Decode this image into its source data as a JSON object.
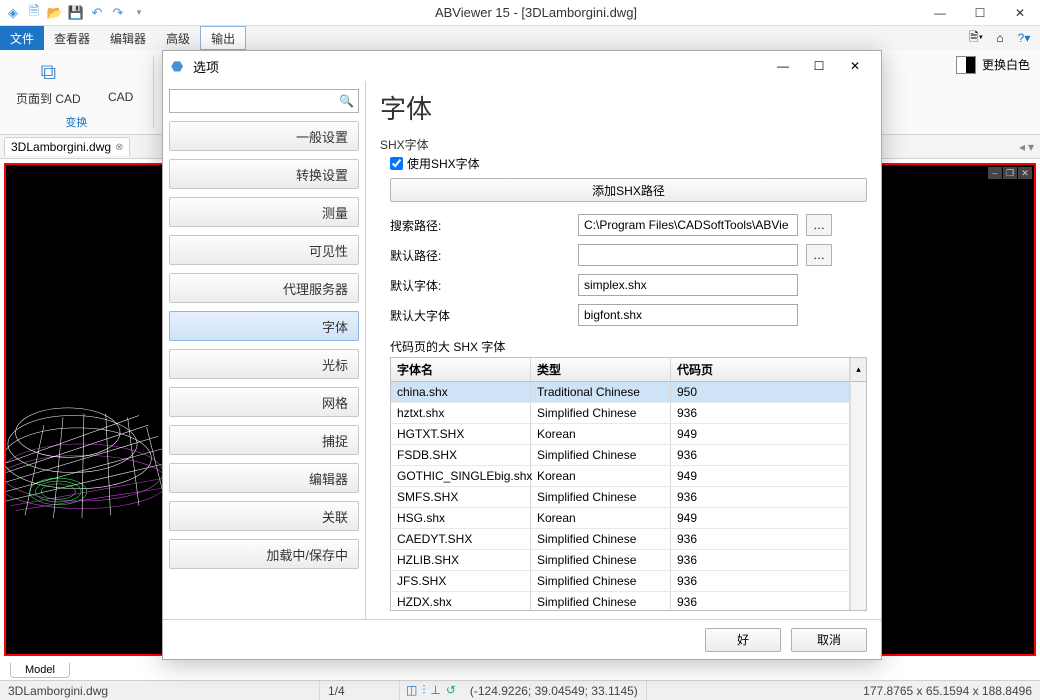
{
  "app": {
    "title": "ABViewer 15 - [3DLamborgini.dwg]"
  },
  "menu": {
    "file": "文件",
    "viewer": "查看器",
    "editor": "编辑器",
    "advanced": "高级",
    "output": "输出"
  },
  "ribbon": {
    "page_to_cad": "页面到 CAD",
    "cad_partial": "CAD",
    "convert": "变换",
    "replace_white": "更换白色"
  },
  "doctab": {
    "name": "3DLamborgini.dwg"
  },
  "modeltab": "Model",
  "status": {
    "file": "3DLamborgini.dwg",
    "page": "1/4",
    "coords": "(-124.9226; 39.04549; 33.1145)",
    "dims": "177.8765 x 65.1594 x 188.8496"
  },
  "dialog": {
    "title": "选项",
    "search_placeholder": "",
    "side": {
      "general": "一般设置",
      "convert": "转换设置",
      "measure": "测量",
      "visibility": "可见性",
      "proxy": "代理服务器",
      "font": "字体",
      "cursor": "光标",
      "grid": "网格",
      "snap": "捕捉",
      "editor": "编辑器",
      "assoc": "关联",
      "loading": "加载中/保存中"
    },
    "main": {
      "heading": "字体",
      "shx_group": "SHX字体",
      "use_shx": "使用SHX字体",
      "add_shx_path": "添加SHX路径",
      "search_path_label": "搜索路径:",
      "search_path_value": "C:\\Program Files\\CADSoftTools\\ABVie",
      "default_path_label": "默认路径:",
      "default_path_value": "",
      "default_font_label": "默认字体:",
      "default_font_value": "simplex.shx",
      "default_bigfont_label": "默认大字体",
      "default_bigfont_value": "bigfont.shx",
      "codepage_label": "代码页的大 SHX 字体",
      "col_name": "字体名",
      "col_type": "类型",
      "col_codepage": "代码页",
      "rows": [
        {
          "name": "china.shx",
          "type": "Traditional Chinese",
          "cp": "950"
        },
        {
          "name": "hztxt.shx",
          "type": "Simplified Chinese",
          "cp": "936"
        },
        {
          "name": "HGTXT.SHX",
          "type": "Korean",
          "cp": "949"
        },
        {
          "name": "FSDB.SHX",
          "type": "Simplified Chinese",
          "cp": "936"
        },
        {
          "name": "GOTHIC_SINGLEbig.shx",
          "type": "Korean",
          "cp": "949"
        },
        {
          "name": "SMFS.SHX",
          "type": "Simplified Chinese",
          "cp": "936"
        },
        {
          "name": "HSG.shx",
          "type": "Korean",
          "cp": "949"
        },
        {
          "name": "CAEDYT.SHX",
          "type": "Simplified Chinese",
          "cp": "936"
        },
        {
          "name": "HZLIB.SHX",
          "type": "Simplified Chinese",
          "cp": "936"
        },
        {
          "name": "JFS.SHX",
          "type": "Simplified Chinese",
          "cp": "936"
        },
        {
          "name": "HZDX.shx",
          "type": "Simplified Chinese",
          "cp": "936"
        }
      ]
    },
    "ok": "好",
    "cancel": "取消"
  }
}
